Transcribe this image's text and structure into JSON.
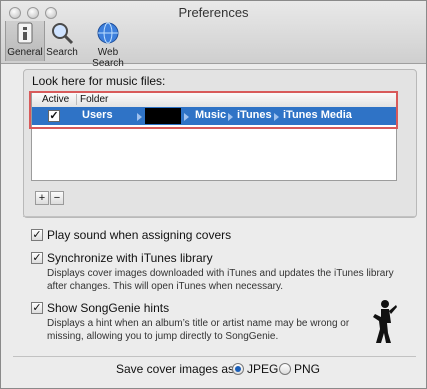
{
  "window": {
    "title": "Preferences"
  },
  "toolbar": {
    "items": [
      {
        "label": "General",
        "icon": "general-icon",
        "selected": true
      },
      {
        "label": "Search",
        "icon": "search-icon",
        "selected": false
      },
      {
        "label": "Web Search",
        "icon": "globe-icon",
        "selected": false
      }
    ]
  },
  "music_files": {
    "heading": "Look here for music files:",
    "columns": [
      "Active",
      "Folder"
    ],
    "rows": [
      {
        "active": true,
        "path": [
          "Users",
          "Music",
          "iTunes",
          "iTunes Media"
        ]
      }
    ],
    "add_label": "+",
    "remove_label": "−"
  },
  "options": {
    "play_sound": {
      "label": "Play sound when assigning covers",
      "checked": true
    },
    "sync_itunes": {
      "label": "Synchronize with iTunes library",
      "checked": true,
      "description_line1": "Displays cover images downloaded with iTunes and updates the iTunes library",
      "description_line2": "after changes. This will open iTunes when necessary."
    },
    "songgenie": {
      "label": "Show SongGenie hints",
      "checked": true,
      "description_line1": "Displays a hint when an album’s title or artist name may be wrong or",
      "description_line2": "missing, allowing you to jump directly to SongGenie."
    }
  },
  "save_format": {
    "label": "Save cover images as:",
    "options": [
      "JPEG",
      "PNG"
    ],
    "selected": "JPEG"
  },
  "colors": {
    "selection": "#2f73c6",
    "highlight_box": "#d85a5a"
  }
}
